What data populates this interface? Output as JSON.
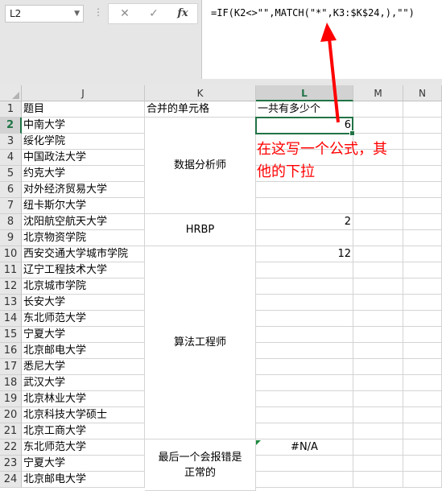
{
  "name_box": {
    "value": "L2"
  },
  "toolbar": {
    "cancel_icon": "✕",
    "enter_icon": "✓",
    "function_label": "fx",
    "separator": "⋮"
  },
  "formula_bar": {
    "formula": "=IF(K2<>\"\",MATCH(\"*\",K3:$K$24,),\"\")"
  },
  "columns": [
    "J",
    "K",
    "L",
    "M",
    "N"
  ],
  "rows": [
    "1",
    "2",
    "3",
    "4",
    "5",
    "6",
    "7",
    "8",
    "9",
    "10",
    "11",
    "12",
    "13",
    "14",
    "15",
    "16",
    "17",
    "18",
    "19",
    "20",
    "21",
    "22",
    "23",
    "24"
  ],
  "headers": {
    "j": "题目",
    "k": "合并的单元格",
    "l": "一共有多少个"
  },
  "col_j": [
    "中南大学",
    "绥化学院",
    "中国政法大学",
    "约克大学",
    "对外经济贸易大学",
    "纽卡斯尔大学",
    "沈阳航空航天大学",
    "北京物资学院",
    "西安交通大学城市学院",
    "辽宁工程技术大学",
    "北京城市学院",
    "长安大学",
    "东北师范大学",
    "宁夏大学",
    "北京邮电大学",
    "悉尼大学",
    "武汉大学",
    "北京林业大学",
    "北京科技大学硕士",
    "北京工商大学",
    "东北师范大学",
    "宁夏大学",
    "北京邮电大学"
  ],
  "merged_k": [
    {
      "label": "数据分析师"
    },
    {
      "label": "HRBP"
    },
    {
      "label": "算法工程师"
    },
    {
      "label": "最后一个会报错是正常的"
    }
  ],
  "col_l": {
    "r2": "6",
    "r8": "2",
    "r10": "12",
    "r22": "#N/A"
  },
  "annotation": {
    "line1": "在这写一个公式，其",
    "line2": "他的下拉",
    "color": "#ff0000"
  },
  "colors": {
    "accent": "#217346",
    "header_bg": "#e7e7e7",
    "annotation": "#ff0000"
  }
}
